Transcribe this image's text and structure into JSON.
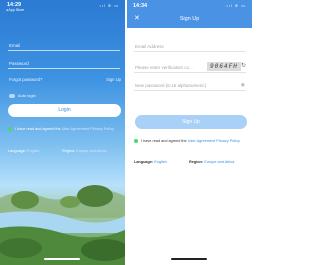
{
  "left": {
    "status": {
      "time": "14:29",
      "sub": "◂ App Store",
      "icons": "ııl ≋ ▭"
    },
    "email_placeholder": "Email",
    "password_placeholder": "Password",
    "forgot_label": "Forgot password?",
    "signup_label": "Sign Up",
    "auto_login_label": "Auto login",
    "login_button": "Login",
    "agree_text": "I have read and agreed the",
    "agree_link": "User Agreement",
    "agree_link2": "Privacy Policy",
    "language_label": "Language:",
    "language_value": "English",
    "region_label": "Region:",
    "region_value": "Europe and Africa"
  },
  "right": {
    "status": {
      "time": "14:34",
      "icons": "ııl ≋ ▭"
    },
    "title": "Sign Up",
    "close_icon": "✕",
    "email_placeholder": "Email Address",
    "code_placeholder": "Please enter verification co...",
    "captcha": "9064FH",
    "refresh_icon": "↻",
    "password_placeholder": "New password (6-16 alphanumeric)",
    "eye_icon": "◉",
    "signup_button": "Sign Up",
    "agree_text": "I have read and agreed the",
    "agree_link": "User Agreement",
    "agree_link2": "Privacy Policy",
    "language_label": "Language:",
    "language_value": "English",
    "region_label": "Region:",
    "region_value": "Europe and Africa"
  },
  "colors": {
    "accent": "#4a92e4",
    "button_disabled": "#a9d0f6",
    "check": "#4cd964"
  }
}
